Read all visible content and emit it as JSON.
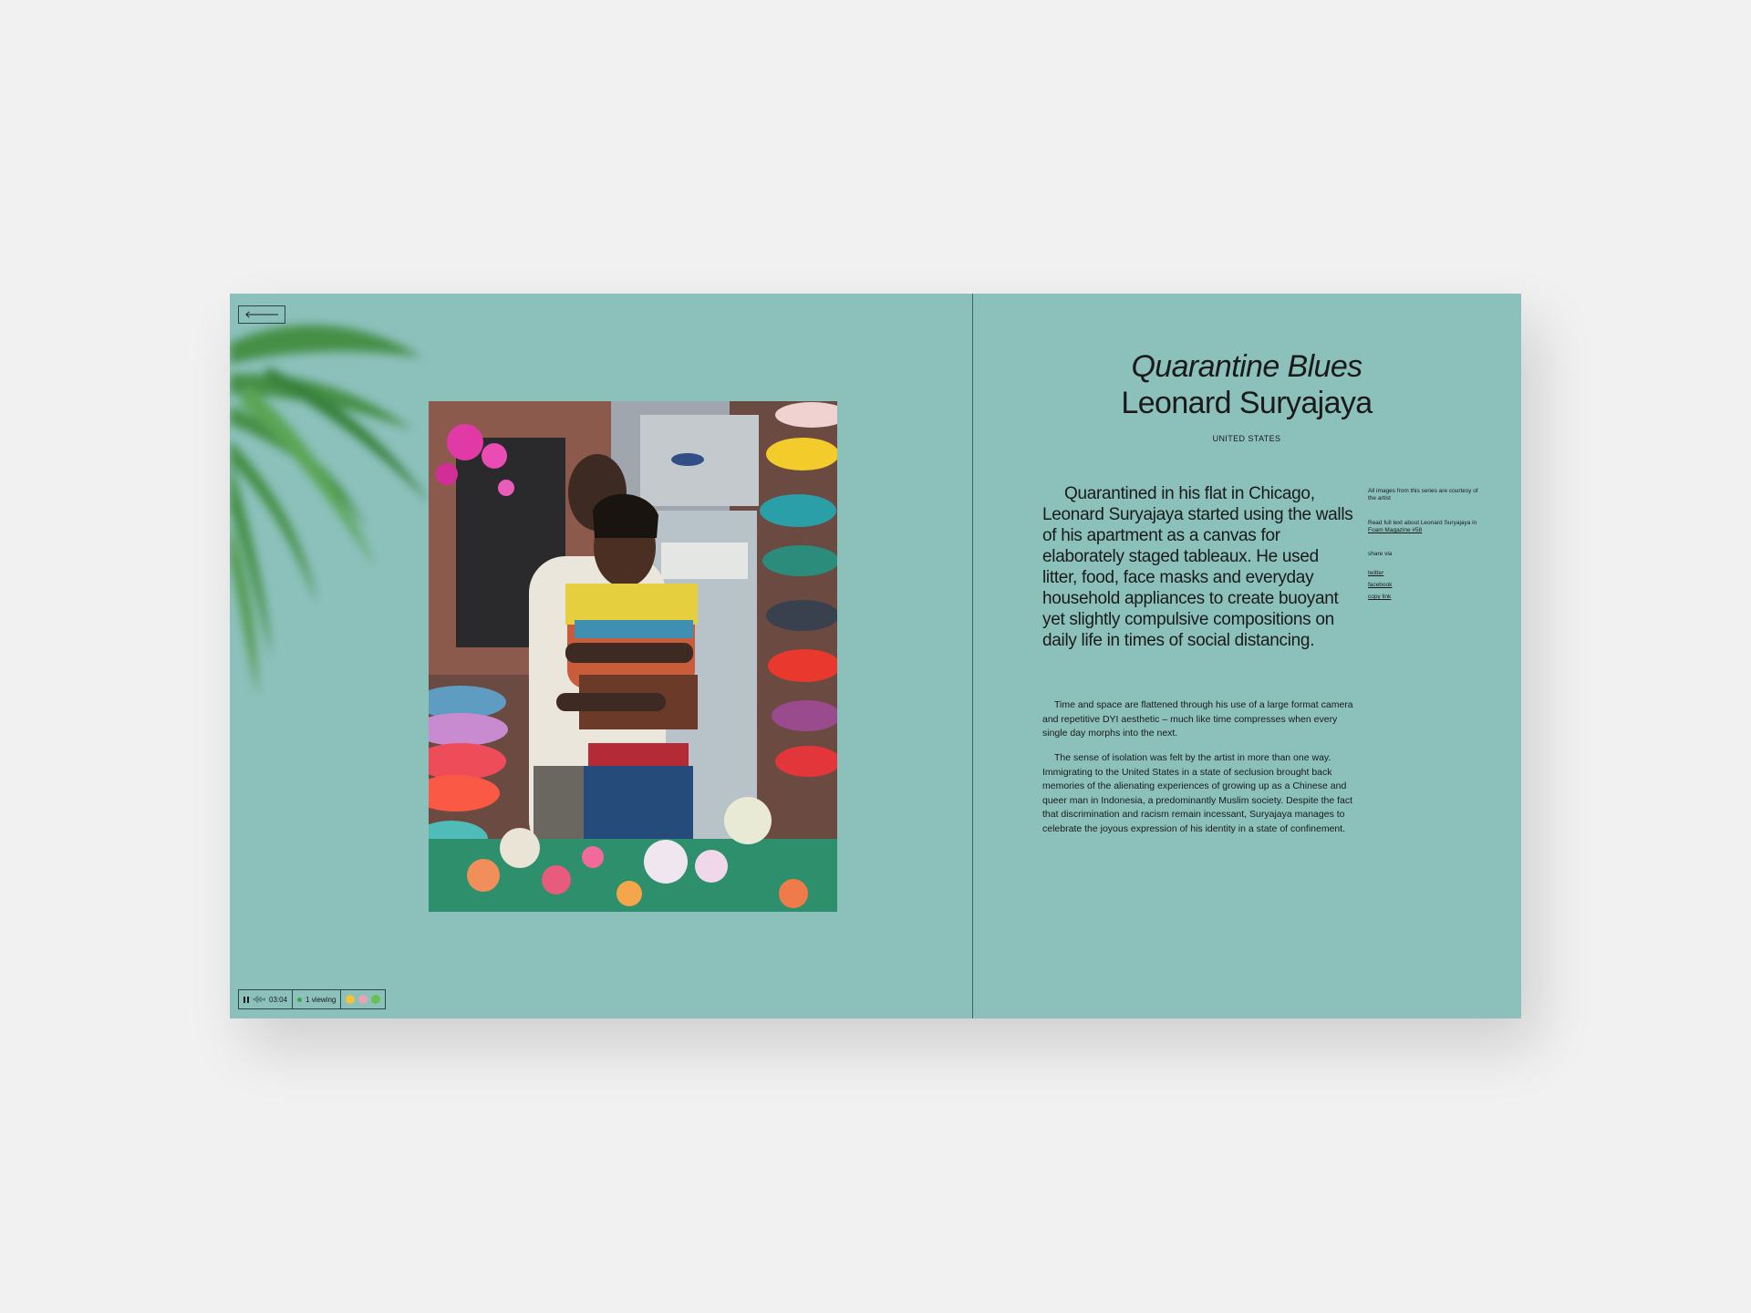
{
  "article": {
    "series_title": "Quarantine Blues",
    "artist": "Leonard Suryajaya",
    "country": "UNITED STATES",
    "lead": "Quarantined in his flat in Chicago, Leonard Suryajaya started using the walls of his apartment as a canvas for elaborately staged tableaux. He used litter, food, face masks and everyday household appliances to create buoyant yet slightly compulsive compositions on daily life in times of social distancing.",
    "paragraphs": [
      "Time and space are flattened through his use of a large format camera and repetitive DYI aesthetic – much like time compresses when every single day morphs into the next.",
      "The sense of isolation was felt by the artist in more than one way. Immigrating to the United States in a state of seclusion brought back memories of the alienating experiences of growing up as a Chinese and queer man in Indonesia, a predominantly Muslim society. Despite the fact that discrimination and racism remain incessant, Suryajaya manages to celebrate the joyous expression of his identity in a state of confinement."
    ]
  },
  "sidebar": {
    "courtesy": "All images from this series are courtesy of the artist",
    "read_full": "Read full text about Leonard Suryajaya in",
    "magazine_link": "Foam Magazine #58",
    "share_label": "share via",
    "share_links": [
      "twitter",
      "facebook",
      "copy link"
    ]
  },
  "status_bar": {
    "time": "03:04",
    "viewing": "1 viewing"
  },
  "icons": {
    "back": "arrow-left-icon",
    "pause": "pause-icon",
    "sound": "sound-wave-icon"
  },
  "colors": {
    "page_background": "#f1f1f1",
    "spread_background": "#8bc0bb",
    "online_dot": "#3fa34d"
  }
}
